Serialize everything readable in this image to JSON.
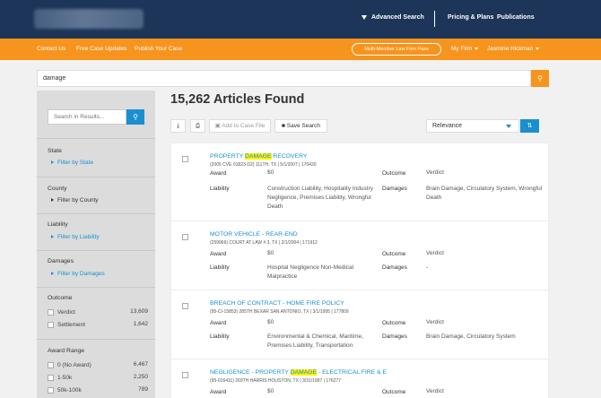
{
  "header": {
    "advanced_search": "Advanced Search",
    "pricing": "Pricing & Plans",
    "publications": "Publications"
  },
  "subnav": {
    "contact": "Contact Us",
    "updates": "Free Case Updates",
    "publish": "Publish Your Case",
    "pass": "Multi-Member Law Firm Pass",
    "firm": "My Firm",
    "user": "Jasmine Hickman"
  },
  "search": {
    "query": "damage"
  },
  "sidebar": {
    "search_placeholder": "Search in Results...",
    "state": {
      "heading": "State",
      "filter": "Filter by State"
    },
    "county": {
      "heading": "County",
      "filter": "Filter by County"
    },
    "liability": {
      "heading": "Liability",
      "filter": "Filter by Liability"
    },
    "damages": {
      "heading": "Damages",
      "filter": "Filter by Damages"
    },
    "outcome": {
      "heading": "Outcome",
      "options": [
        {
          "label": "Verdict",
          "count": "13,609"
        },
        {
          "label": "Settlement",
          "count": "1,642"
        }
      ]
    },
    "award_range": {
      "heading": "Award Range",
      "options": [
        {
          "label": "0 (No Award)",
          "count": "6,467"
        },
        {
          "label": "1-50k",
          "count": "2,250"
        },
        {
          "label": "50k-100k",
          "count": "789"
        }
      ]
    }
  },
  "results": {
    "title": "15,262 Articles Found",
    "toolbar": {
      "add_case": "Add to Case File",
      "save_search": "Save Search"
    },
    "sort": {
      "selected": "Relevance"
    },
    "labels": {
      "award": "Award",
      "liability": "Liability",
      "outcome": "Outcome",
      "damages": "Damages"
    },
    "items": [
      {
        "title_before": "Property ",
        "title_highlight": "Damage",
        "title_after": " Recovery",
        "meta": "(2005 CVE 01823-D2) 111TH, TX | 5/1/2007 | 170420",
        "award": "$0",
        "outcome": "Verdict",
        "liability": "Construction Liability, Hospitality Industry Negligence, Premises Liability, Wrongful Death",
        "damages": "Brain Damage, Circulatory System, Wrongful Death"
      },
      {
        "title_before": "Motor Vehicle - Rear-End",
        "title_highlight": "",
        "title_after": "",
        "meta": "(259966) COURT AT LAW # 3, TX | 2/1/2004 | 171912",
        "award": "$0",
        "outcome": "Verdict",
        "liability": "Hospital Negligence Non-Medical Malpractice",
        "damages": "-"
      },
      {
        "title_before": "Breach of Contract - Home Fire Policy",
        "title_highlight": "",
        "title_after": "",
        "meta": "(95-CI-15853) 285TH BEXAR SAN ANTONIO, TX | 3/1/1995 | 177809",
        "award": "$0",
        "outcome": "Verdict",
        "liability": "Environmental & Chemical, Maritime, Premises Liability, Transportation",
        "damages": "Brain Damage, Circulatory System"
      },
      {
        "title_before": "Negligence - Property ",
        "title_highlight": "Damage",
        "title_after": " - Electrical Fire & E",
        "meta": "(95-016411) 269TH HARRIS HOUSTON, TX | 3/31/1997 | 176277",
        "award": "$0",
        "outcome": "Verdict",
        "liability": "",
        "damages": ""
      }
    ]
  }
}
